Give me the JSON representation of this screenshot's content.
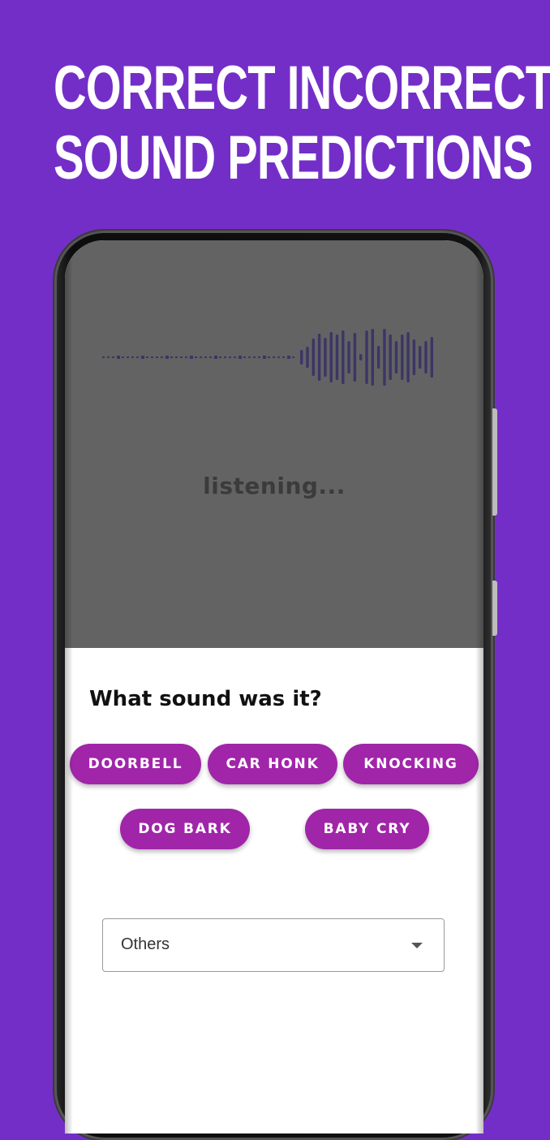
{
  "headline": {
    "line1": "Correct Incorrect",
    "line2": "sound predictions"
  },
  "colors": {
    "background": "#742ec8",
    "chip": "#a025a9",
    "waveform": "#3c3566",
    "overlay": "#636363"
  },
  "listening_screen": {
    "status_text": "listening..."
  },
  "feedback_sheet": {
    "title": "What sound was it?",
    "options": [
      "DOORBELL",
      "CAR HONK",
      "KNOCKING",
      "DOG BARK",
      "BABY CRY"
    ],
    "dropdown": {
      "selected": "Others",
      "icon": "caret-down-icon"
    }
  }
}
